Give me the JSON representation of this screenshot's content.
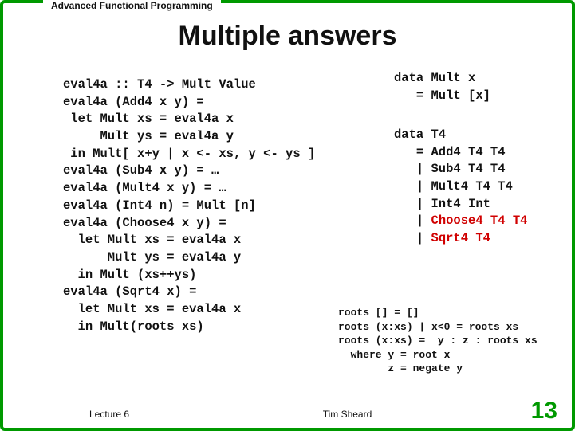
{
  "header_tab": "Advanced Functional Programming",
  "title": "Multiple answers",
  "code_left": {
    "l01": "eval4a :: T4 -> Mult Value",
    "l02": "eval4a (Add4 x y) =",
    "l03": " let Mult xs = eval4a x",
    "l04": "     Mult ys = eval4a y",
    "l05": " in Mult[ x+y | x <- xs, y <- ys ]",
    "l06": "eval4a (Sub4 x y) = …",
    "l07": "eval4a (Mult4 x y) = …",
    "l08": "eval4a (Int4 n) = Mult [n]",
    "l09": "eval4a (Choose4 x y) =",
    "l10": "  let Mult xs = eval4a x",
    "l11": "      Mult ys = eval4a y",
    "l12": "  in Mult (xs++ys)",
    "l13": "eval4a (Sqrt4 x) =",
    "l14": "  let Mult xs = eval4a x",
    "l15": "  in Mult(roots xs)"
  },
  "code_right_top": {
    "l1": "data Mult x",
    "l2": "   = Mult [x]"
  },
  "code_right_mid": {
    "l1": "data T4",
    "l2": "   = Add4 T4 T4",
    "l3": "   | Sub4 T4 T4",
    "l4": "   | Mult4 T4 T4",
    "l5": "   | Int4 Int",
    "l6a": "   | ",
    "l6b": "Choose4 T4 T4",
    "l7a": "   | ",
    "l7b": "Sqrt4 T4"
  },
  "code_right_bot": {
    "l1": "roots [] = []",
    "l2": "roots (x:xs) | x<0 = roots xs",
    "l3": "roots (x:xs) =  y : z : roots xs",
    "l4": "  where y = root x",
    "l5": "        z = negate y"
  },
  "footer": {
    "left": "Lecture 6",
    "mid": "Tim Sheard",
    "right": "13"
  }
}
